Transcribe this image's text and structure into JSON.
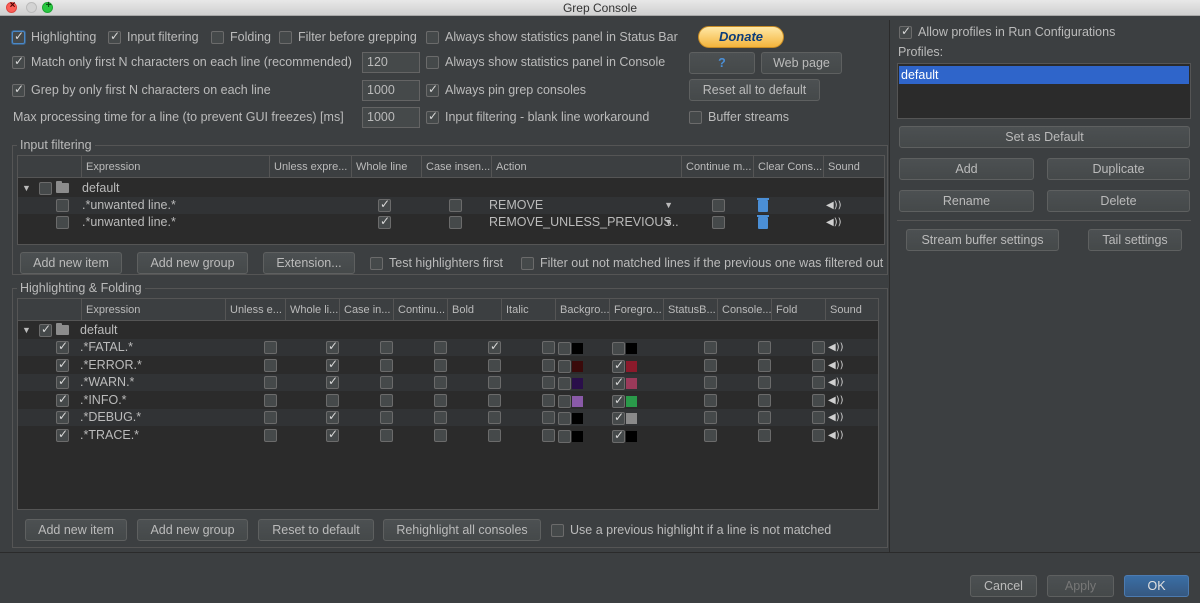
{
  "window": {
    "title": "Grep Console"
  },
  "top_options": {
    "highlighting": "Highlighting",
    "input_filtering": "Input filtering",
    "folding": "Folding",
    "filter_before_grepping": "Filter before grepping",
    "always_show_stats_status": "Always show statistics panel in Status Bar",
    "match_first_n": "Match only first N characters on each line (recommended)",
    "match_first_n_value": "120",
    "always_show_stats_console": "Always show statistics panel in Console",
    "grep_first_n": "Grep by only first N characters on each line",
    "grep_first_n_value": "1000",
    "always_pin": "Always pin grep consoles",
    "max_processing": "Max processing time for a line (to prevent GUI freezes) [ms]",
    "max_processing_value": "1000",
    "blank_line_workaround": "Input filtering - blank line workaround",
    "buffer_streams": "Buffer streams",
    "donate": "Donate",
    "help": "?",
    "web_page": "Web page",
    "reset_all": "Reset all to default"
  },
  "input_filtering": {
    "title": "Input filtering",
    "columns": [
      "Expression",
      "Unless expre...",
      "Whole line",
      "Case insen...",
      "Action",
      "Continue m...",
      "Clear Cons...",
      "Sound"
    ],
    "group_name": "default",
    "rows": [
      {
        "expression": ".*unwanted line.*",
        "action": "REMOVE"
      },
      {
        "expression": ".*unwanted line.*",
        "action": "REMOVE_UNLESS_PREVIOUS..."
      }
    ],
    "buttons": {
      "add_item": "Add new item",
      "add_group": "Add new group",
      "extension": "Extension...",
      "test_first": "Test highlighters first",
      "filter_out": "Filter out not matched lines if the previous one was filtered out"
    }
  },
  "highlighting": {
    "title": "Highlighting & Folding",
    "columns": [
      "Expression",
      "Unless e...",
      "Whole li...",
      "Case in...",
      "Continu...",
      "Bold",
      "Italic",
      "Backgro...",
      "Foregro...",
      "StatusB...",
      "Console...",
      "Fold",
      "Sound"
    ],
    "group_name": "default",
    "rows": [
      {
        "expression": ".*FATAL.*",
        "whole": true,
        "bold": true,
        "bg": "#000000",
        "bg_on": false,
        "fg": "#000000",
        "fg_on": false
      },
      {
        "expression": ".*ERROR.*",
        "whole": true,
        "bold": false,
        "bg": "#3a0a0a",
        "bg_on": false,
        "fg": "#8b1a2b",
        "fg_on": true
      },
      {
        "expression": ".*WARN.*",
        "whole": true,
        "bold": false,
        "bg": "#2a0f4a",
        "bg_on": false,
        "fg": "#9b3a5a",
        "fg_on": true
      },
      {
        "expression": ".*INFO.*",
        "whole": false,
        "bold": false,
        "bg": "#8a5aa8",
        "bg_on": false,
        "fg": "#2a9a4a",
        "fg_on": true
      },
      {
        "expression": ".*DEBUG.*",
        "whole": true,
        "bold": false,
        "bg": "#000000",
        "bg_on": false,
        "fg": "#8a8a8a",
        "fg_on": true
      },
      {
        "expression": ".*TRACE.*",
        "whole": true,
        "bold": false,
        "bg": "#000000",
        "bg_on": false,
        "fg": "#000000",
        "fg_on": true
      }
    ],
    "buttons": {
      "add_item": "Add new item",
      "add_group": "Add new group",
      "reset": "Reset to default",
      "rehighlight": "Rehighlight all consoles",
      "use_previous": "Use a previous highlight if a line is not matched"
    }
  },
  "right_panel": {
    "allow_profiles": "Allow profiles in Run Configurations",
    "profiles_label": "Profiles:",
    "profiles": [
      "default"
    ],
    "set_default": "Set as Default",
    "add": "Add",
    "duplicate": "Duplicate",
    "rename": "Rename",
    "delete": "Delete",
    "stream_buffer": "Stream buffer settings",
    "tail": "Tail settings"
  },
  "footer": {
    "cancel": "Cancel",
    "apply": "Apply",
    "ok": "OK"
  }
}
